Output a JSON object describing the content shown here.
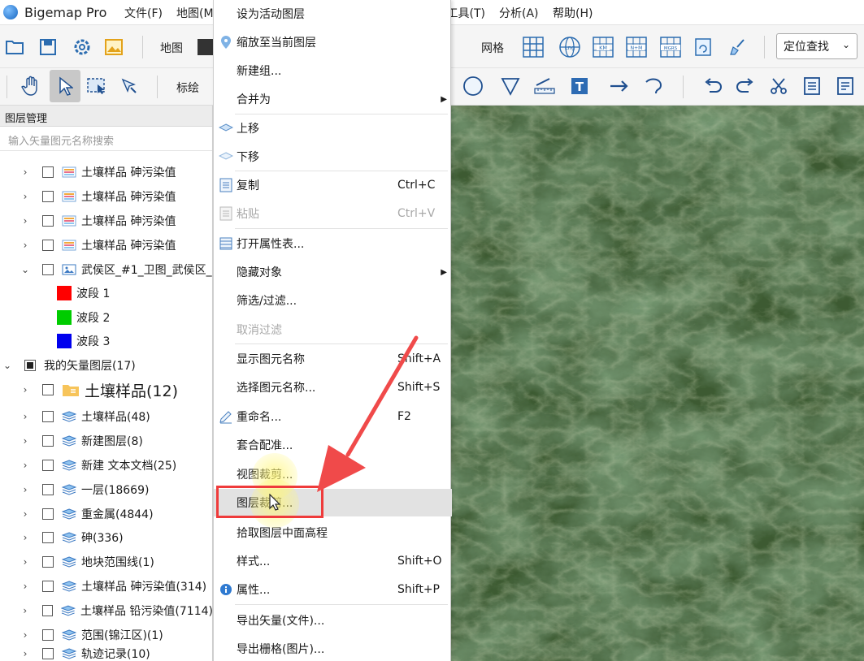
{
  "app": {
    "title": "Bigemap Pro"
  },
  "menubar": {
    "file": "文件(F)",
    "map": "地图(M",
    "tools": "工具(T)",
    "tools_clipped": "工具(T)",
    "analysis": "分析(A)",
    "help": "帮助(H)"
  },
  "toolbar1": {
    "map_label": "地图",
    "grid_label": "网格",
    "lng_badge": "Lng",
    "km_badge": "KM",
    "nm_badge": "N+M",
    "mgrs_badge": "MGRS",
    "locate_select": "定位查找"
  },
  "toolbar2": {
    "mark_label": "标绘",
    "text_badge": "T"
  },
  "layer_panel": {
    "header": "图层管理",
    "search_placeholder": "输入矢量图元名称搜索",
    "rows": [
      {
        "label": "土壤样品 砷污染值"
      },
      {
        "label": "土壤样品 砷污染值"
      },
      {
        "label": "土壤样品 砷污染值"
      },
      {
        "label": "土壤样品 砷污染值"
      },
      {
        "label": "武侯区_#1_卫图_武侯区_"
      },
      {
        "label": "波段 1",
        "color": "#ff0000"
      },
      {
        "label": "波段 2",
        "color": "#00cc00"
      },
      {
        "label": "波段 3",
        "color": "#0000ee"
      },
      {
        "label": "我的矢量图层(17)"
      },
      {
        "label": "土壤样品(12)"
      },
      {
        "label": "土壤样品(48)"
      },
      {
        "label": "新建图层(8)"
      },
      {
        "label": "新建 文本文档(25)"
      },
      {
        "label": "一层(18669)"
      },
      {
        "label": "重金属(4844)"
      },
      {
        "label": "砷(336)"
      },
      {
        "label": "地块范围线(1)"
      },
      {
        "label": "土壤样品 砷污染值(314)"
      },
      {
        "label": "土壤样品 铅污染值(7114)"
      },
      {
        "label": "范围(锦江区)(1)"
      },
      {
        "label": "轨迹记录(10)"
      }
    ]
  },
  "context_menu": {
    "items": [
      {
        "label": "设为活动图层"
      },
      {
        "label": "缩放至当前图层"
      },
      {
        "label": "新建组..."
      },
      {
        "label": "合并为"
      },
      {
        "label": "上移"
      },
      {
        "label": "下移"
      },
      {
        "label": "复制",
        "shortcut": "Ctrl+C"
      },
      {
        "label": "粘贴",
        "shortcut": "Ctrl+V"
      },
      {
        "label": "打开属性表..."
      },
      {
        "label": "隐藏对象"
      },
      {
        "label": "筛选/过滤..."
      },
      {
        "label": "取消过滤"
      },
      {
        "label": "显示图元名称",
        "shortcut": "Shift+A"
      },
      {
        "label": "选择图元名称...",
        "shortcut": "Shift+S"
      },
      {
        "label": "重命名...",
        "shortcut": "F2"
      },
      {
        "label": "套合配准..."
      },
      {
        "label": "视图裁剪..."
      },
      {
        "label": "图层裁剪..."
      },
      {
        "label": "拾取图层中面高程"
      },
      {
        "label": "样式...",
        "shortcut": "Shift+O"
      },
      {
        "label": "属性...",
        "shortcut": "Shift+P"
      },
      {
        "label": "导出矢量(文件)..."
      },
      {
        "label": "导出栅格(图片)..."
      }
    ]
  },
  "colors": {
    "highlight_border": "#ef3b3b",
    "arrow": "#f04a4a",
    "map_base": "#38522c"
  }
}
